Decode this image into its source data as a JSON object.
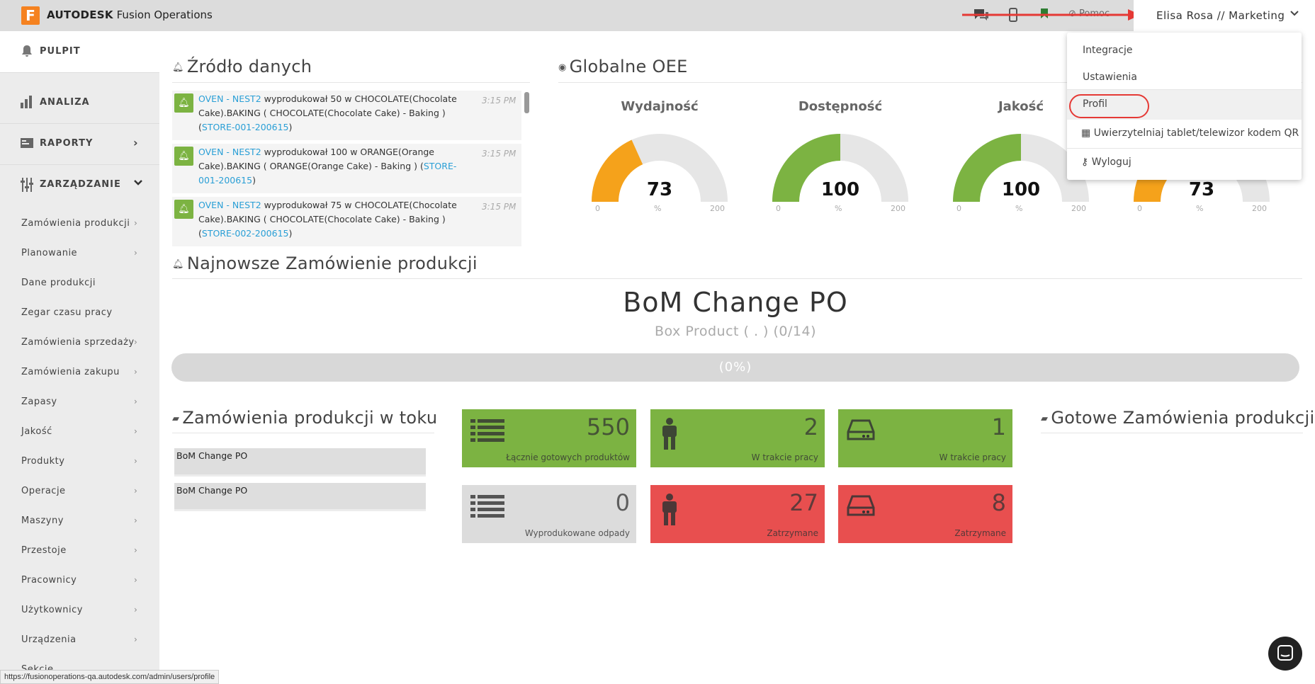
{
  "app": {
    "logo_letter": "F",
    "brand_bold": "AUTODESK",
    "brand_rest": "Fusion Operations"
  },
  "topbar": {
    "help": "Pomoc",
    "user": "Elisa Rosa // Marketing"
  },
  "sidebar": {
    "main": [
      {
        "label": "PULPIT",
        "icon": "bell-icon"
      },
      {
        "label": "ANALIZA",
        "icon": "bar-chart-icon"
      },
      {
        "label": "RAPORTY",
        "icon": "report-icon",
        "arrow": "›"
      },
      {
        "label": "ZARZĄDZANIE",
        "icon": "sliders-icon",
        "arrow": "⌄"
      }
    ],
    "sub": [
      {
        "label": "Zamówienia produkcji",
        "arrow": "›"
      },
      {
        "label": "Planowanie",
        "arrow": "›"
      },
      {
        "label": "Dane produkcji",
        "arrow": ""
      },
      {
        "label": "Zegar czasu pracy",
        "arrow": ""
      },
      {
        "label": "Zamówienia sprzedaży",
        "arrow": "›"
      },
      {
        "label": "Zamówienia zakupu",
        "arrow": "›"
      },
      {
        "label": "Zapasy",
        "arrow": "›"
      },
      {
        "label": "Jakość",
        "arrow": "›"
      },
      {
        "label": "Produkty",
        "arrow": "›"
      },
      {
        "label": "Operacje",
        "arrow": "›"
      },
      {
        "label": "Maszyny",
        "arrow": "›"
      },
      {
        "label": "Przestoje",
        "arrow": "›"
      },
      {
        "label": "Pracownicy",
        "arrow": "›"
      },
      {
        "label": "Użytkownicy",
        "arrow": "›"
      },
      {
        "label": "Urządzenia",
        "arrow": "›"
      },
      {
        "label": "Sekcje",
        "arrow": ""
      }
    ]
  },
  "source": {
    "title": "Źródło danych",
    "items": [
      {
        "machine": "OVEN - NEST2",
        "text1": " wyprodukował 50 w CHOCOLATE(Chocolate Cake).BAKING ( CHOCOLATE(Chocolate Cake) - Baking ) (",
        "store": "STORE-001-200615",
        "text2": ")",
        "time": "3:15 PM"
      },
      {
        "machine": "OVEN - NEST2",
        "text1": " wyprodukował 100 w ORANGE(Orange Cake).BAKING ( ORANGE(Orange Cake) - Baking ) (",
        "store": "STORE-001-200615",
        "text2": ")",
        "time": "3:15 PM"
      },
      {
        "machine": "OVEN - NEST2",
        "text1": " wyprodukował 75 w CHOCOLATE(Chocolate Cake).BAKING ( CHOCOLATE(Chocolate Cake) - Baking ) (",
        "store": "STORE-002-200615",
        "text2": ")",
        "time": "3:15 PM"
      }
    ]
  },
  "oee": {
    "title": "Globalne OEE",
    "gauges": [
      {
        "label": "Wydajność",
        "value": "73",
        "unit": "%",
        "min": "0",
        "max": "200",
        "fraction": 0.365,
        "color": "#f5a21b"
      },
      {
        "label": "Dostępność",
        "value": "100",
        "unit": "%",
        "min": "0",
        "max": "200",
        "fraction": 0.5,
        "color": "#7cb342"
      },
      {
        "label": "Jakość",
        "value": "100",
        "unit": "%",
        "min": "0",
        "max": "200",
        "fraction": 0.5,
        "color": "#7cb342"
      },
      {
        "label": "",
        "value": "73",
        "unit": "%",
        "min": "0",
        "max": "200",
        "fraction": 0.365,
        "color": "#f5a21b"
      }
    ]
  },
  "dropdown": {
    "items": [
      {
        "label": "Integracje"
      },
      {
        "label": "Ustawienia"
      },
      {
        "label": "Profil"
      },
      {
        "label": "Uwierzytelniaj tablet/telewizor kodem QR",
        "icon": "qr-icon"
      },
      {
        "label": "Wyloguj",
        "icon": "key-icon"
      }
    ]
  },
  "latest": {
    "title": "Najnowsze Zamówienie produkcji",
    "po_name": "BoM Change PO",
    "po_sub": "Box Product ( . ) (0/14)",
    "progress_label": "(0%)",
    "progress": 0
  },
  "wip": {
    "title": "Zamówienia produkcji w toku",
    "items": [
      "BoM Change PO",
      "BoM Change PO"
    ]
  },
  "tiles": [
    {
      "value": "550",
      "caption": "Łącznie gotowych produktów",
      "icon": "list-icon",
      "color": "green"
    },
    {
      "value": "2",
      "caption": "W trakcie pracy",
      "icon": "person-icon",
      "color": "green"
    },
    {
      "value": "1",
      "caption": "W trakcie pracy",
      "icon": "drive-icon",
      "color": "green"
    },
    {
      "value": "0",
      "caption": "Wyprodukowane odpady",
      "icon": "list-icon",
      "color": "grey"
    },
    {
      "value": "27",
      "caption": "Zatrzymane",
      "icon": "person-icon",
      "color": "red"
    },
    {
      "value": "8",
      "caption": "Zatrzymane",
      "icon": "drive-icon",
      "color": "red"
    }
  ],
  "finished": {
    "title": "Gotowe Zamówienia produkcji"
  },
  "statusbar": {
    "url": "https://fusionoperations-qa.autodesk.com/admin/users/profile"
  }
}
